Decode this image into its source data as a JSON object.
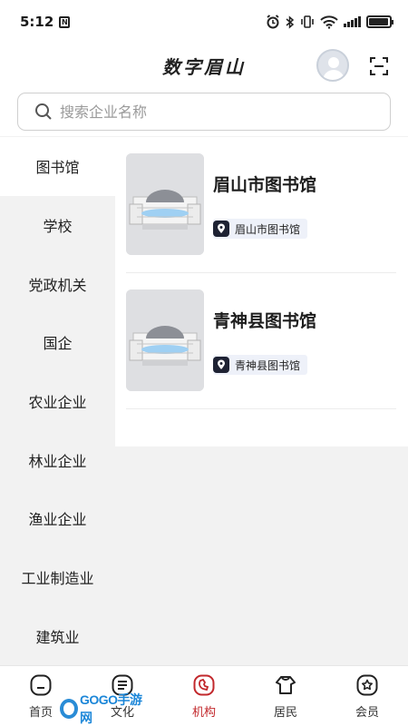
{
  "status_bar": {
    "time": "5:12",
    "nfc": "N"
  },
  "header": {
    "title": "数字眉山"
  },
  "search": {
    "placeholder": "搜索企业名称"
  },
  "sidebar": {
    "items": [
      {
        "label": "图书馆",
        "active": true
      },
      {
        "label": "学校"
      },
      {
        "label": "党政机关"
      },
      {
        "label": "国企"
      },
      {
        "label": "农业企业"
      },
      {
        "label": "林业企业"
      },
      {
        "label": "渔业企业"
      },
      {
        "label": "工业制造业"
      },
      {
        "label": "建筑业"
      }
    ]
  },
  "cards": [
    {
      "name": "眉山市图书馆",
      "tag": "眉山市图书馆"
    },
    {
      "name": "青神县图书馆",
      "tag": "青神县图书馆"
    }
  ],
  "tabbar": {
    "items": [
      {
        "label": "首页",
        "icon": "home-icon"
      },
      {
        "label": "文化",
        "icon": "list-icon"
      },
      {
        "label": "机构",
        "icon": "institution-icon",
        "active": true
      },
      {
        "label": "居民",
        "icon": "resident-icon"
      },
      {
        "label": "会员",
        "icon": "member-icon"
      }
    ]
  },
  "watermark": {
    "text": "GOGO手游网"
  },
  "colors": {
    "accent": "#c2282c",
    "tag_bg": "#eef1f9",
    "sidebar_bg": "#f2f2f2"
  }
}
